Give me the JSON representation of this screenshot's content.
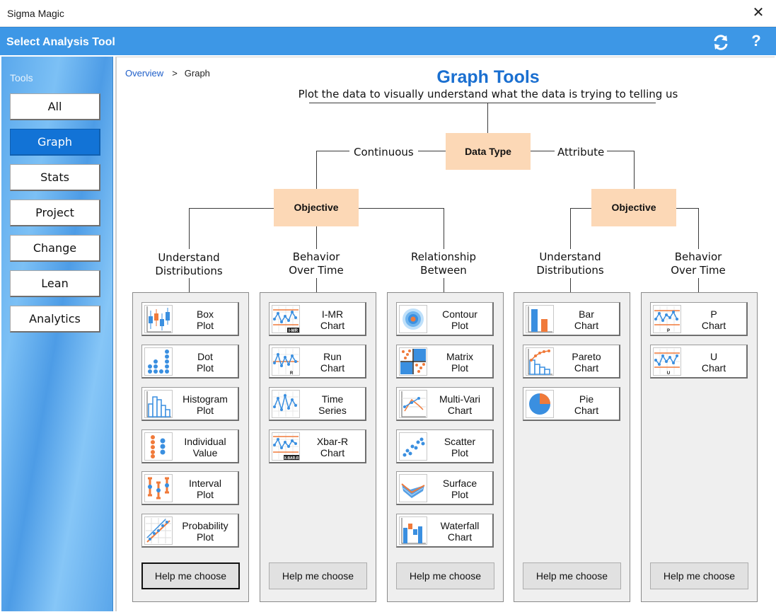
{
  "window": {
    "title": "Sigma Magic",
    "close_glyph": "✕"
  },
  "header": {
    "title": "Select Analysis Tool",
    "help_glyph": "?"
  },
  "sidebar": {
    "label": "Tools",
    "items": [
      {
        "label": "All"
      },
      {
        "label": "Graph"
      },
      {
        "label": "Stats"
      },
      {
        "label": "Project"
      },
      {
        "label": "Change"
      },
      {
        "label": "Lean"
      },
      {
        "label": "Analytics"
      }
    ],
    "active": "Graph"
  },
  "breadcrumb": {
    "link": "Overview",
    "sep": ">",
    "current": "Graph"
  },
  "page": {
    "title": "Graph Tools",
    "subtitle": "Plot the data to visually understand what the data is trying to telling us"
  },
  "tree": {
    "root": "Data Type",
    "branches": {
      "left": "Continuous",
      "right": "Attribute"
    },
    "objective_left": "Objective",
    "objective_right": "Objective",
    "objectives": [
      {
        "line1": "Understand",
        "line2": "Distributions"
      },
      {
        "line1": "Behavior",
        "line2": "Over Time"
      },
      {
        "line1": "Relationship",
        "line2": "Between"
      },
      {
        "line1": "Understand",
        "line2": "Distributions"
      },
      {
        "line1": "Behavior",
        "line2": "Over Time"
      }
    ]
  },
  "panels": [
    {
      "tools": [
        {
          "line1": "Box",
          "line2": "Plot",
          "icon": "box-plot"
        },
        {
          "line1": "Dot",
          "line2": "Plot",
          "icon": "dot-plot"
        },
        {
          "line1": "Histogram",
          "line2": "Plot",
          "icon": "histogram"
        },
        {
          "line1": "Individual",
          "line2": "Value",
          "icon": "individual-value"
        },
        {
          "line1": "Interval",
          "line2": "Plot",
          "icon": "interval-plot"
        },
        {
          "line1": "Probability",
          "line2": "Plot",
          "icon": "probability-plot"
        }
      ],
      "help": "Help me choose"
    },
    {
      "tools": [
        {
          "line1": "I-MR",
          "line2": "Chart",
          "icon": "imr-chart",
          "tag": "I-MR"
        },
        {
          "line1": "Run",
          "line2": "Chart",
          "icon": "run-chart",
          "tag": "R"
        },
        {
          "line1": "Time",
          "line2": "Series",
          "icon": "time-series"
        },
        {
          "line1": "Xbar-R",
          "line2": "Chart",
          "icon": "xbar-r-chart",
          "tag": "X-BAR-R"
        }
      ],
      "help": "Help me choose"
    },
    {
      "tools": [
        {
          "line1": "Contour",
          "line2": "Plot",
          "icon": "contour-plot"
        },
        {
          "line1": "Matrix",
          "line2": "Plot",
          "icon": "matrix-plot"
        },
        {
          "line1": "Multi-Vari",
          "line2": "Chart",
          "icon": "multi-vari-chart"
        },
        {
          "line1": "Scatter",
          "line2": "Plot",
          "icon": "scatter-plot"
        },
        {
          "line1": "Surface",
          "line2": "Plot",
          "icon": "surface-plot"
        },
        {
          "line1": "Waterfall",
          "line2": "Chart",
          "icon": "waterfall-chart"
        }
      ],
      "help": "Help me choose"
    },
    {
      "tools": [
        {
          "line1": "Bar",
          "line2": "Chart",
          "icon": "bar-chart"
        },
        {
          "line1": "Pareto",
          "line2": "Chart",
          "icon": "pareto-chart"
        },
        {
          "line1": "Pie",
          "line2": "Chart",
          "icon": "pie-chart"
        }
      ],
      "help": "Help me choose"
    },
    {
      "tools": [
        {
          "line1": "P",
          "line2": "Chart",
          "icon": "p-chart",
          "tag": "P"
        },
        {
          "line1": "U",
          "line2": "Chart",
          "icon": "u-chart",
          "tag": "U"
        }
      ],
      "help": "Help me choose"
    }
  ],
  "colors": {
    "accent": "#3d97e6",
    "active_nav": "#1273d6",
    "node_fill": "#fcd8b6",
    "title": "#1a6fd0",
    "icon_blue": "#3a8fe0",
    "icon_orange": "#f07a3a"
  }
}
